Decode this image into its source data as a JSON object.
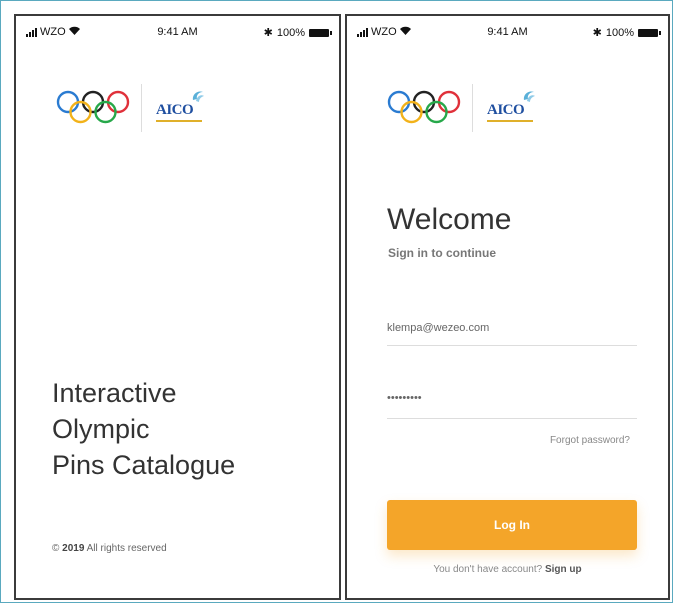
{
  "status_bar": {
    "carrier": "WZO",
    "time": "9:41 AM",
    "battery": "100%",
    "bluetooth": "✱"
  },
  "left_screen": {
    "logo_text": "AICO",
    "hero_title": [
      "Interactive",
      "Olympic",
      "Pins Catalogue"
    ],
    "copyright_symbol": "©",
    "copyright_year": "2019",
    "copyright_text": "All rights reserved"
  },
  "right_screen": {
    "logo_text": "AICO",
    "welcome": "Welcome",
    "subtitle": "Sign in to continue",
    "email_value": "klempa@wezeo.com",
    "password_value": "•••••••••",
    "forgot_label": "Forgot password?",
    "login_label": "Log In",
    "signup_prompt": "You don't have account?",
    "signup_link": "Sign up"
  },
  "colors": {
    "accent": "#f4a529",
    "aico_blue": "#1f4fa0",
    "frame": "#5aa9bf"
  }
}
